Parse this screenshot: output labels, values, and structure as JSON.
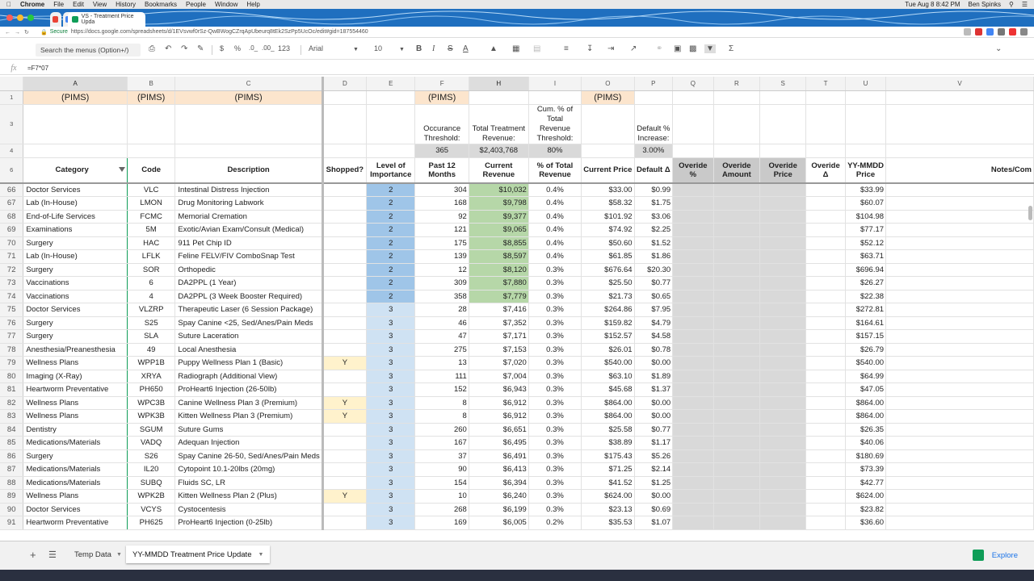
{
  "mac_menu": {
    "app": "Chrome",
    "items": [
      "File",
      "Edit",
      "View",
      "History",
      "Bookmarks",
      "People",
      "Window",
      "Help"
    ],
    "clock": "Tue Aug 8  8:42 PM",
    "user": "Ben Spinks"
  },
  "browser": {
    "tabs": [
      {
        "label": "VS - Treatment Price Upda",
        "active": true
      }
    ],
    "secure_label": "Secure",
    "url": "https://docs.google.com/spreadsheets/d/1EVsvwf0rSz-QwBWogCZrqApUbeurq8tEk2SzPp5UcOc/edit#gid=187554460"
  },
  "toolbar": {
    "search_placeholder": "Search the menus (Option+/)",
    "buttons": [
      "print",
      "undo",
      "redo",
      "paint-format",
      "$",
      "%",
      ".0_",
      ".00_",
      "123"
    ],
    "font": "Arial",
    "font_size": "10"
  },
  "formula_bar": {
    "fx": "fx",
    "formula": "=F7*07"
  },
  "columns": [
    "A",
    "B",
    "C",
    "D",
    "E",
    "F",
    "H",
    "I",
    "O",
    "P",
    "Q",
    "R",
    "S",
    "T",
    "U",
    "V"
  ],
  "header_rows": {
    "row1": {
      "rownum": "1",
      "A": "(PIMS)",
      "B": "(PIMS)",
      "C": "(PIMS)",
      "F": "(PIMS)",
      "O": "(PIMS)"
    },
    "row3": {
      "rownum": "3",
      "F": "Occurance Threshold:",
      "H": "Total Treatment Revenue:",
      "I": "Cum. % of Total Revenue Threshold:",
      "P": "Default % Increase:"
    },
    "row4": {
      "rownum": "4",
      "F": "365",
      "H": "$2,403,768",
      "I": "80%",
      "P": "3.00%"
    },
    "row6": {
      "rownum": "6",
      "A": "Category",
      "B": "Code",
      "C": "Description",
      "D": "Shopped?",
      "E": "Level of Importance",
      "F": "Past 12 Months",
      "H": "Current Revenue",
      "I": "% of Total Revenue",
      "O": "Current Price",
      "P": "Default Δ",
      "Q": "Overide %",
      "R": "Overide Amount",
      "S": "Overide Price",
      "T": "Overide Δ",
      "U": "YY-MMDD Price",
      "V": "Notes/Com"
    }
  },
  "rows": [
    {
      "n": "66",
      "cat": "Doctor Services",
      "code": "VLC",
      "desc": "Intestinal Distress Injection",
      "shop": "",
      "lvl": "2",
      "past": "304",
      "rev": "$10,032",
      "pct": "0.4%",
      "price": "$33.00",
      "delta": "$0.99",
      "yy": "$33.99"
    },
    {
      "n": "67",
      "cat": "Lab (In-House)",
      "code": "LMON",
      "desc": "Drug Monitoring Labwork",
      "shop": "",
      "lvl": "2",
      "past": "168",
      "rev": "$9,798",
      "pct": "0.4%",
      "price": "$58.32",
      "delta": "$1.75",
      "yy": "$60.07"
    },
    {
      "n": "68",
      "cat": "End-of-Life Services",
      "code": "FCMC",
      "desc": "Memorial Cremation",
      "shop": "",
      "lvl": "2",
      "past": "92",
      "rev": "$9,377",
      "pct": "0.4%",
      "price": "$101.92",
      "delta": "$3.06",
      "yy": "$104.98"
    },
    {
      "n": "69",
      "cat": "Examinations",
      "code": "5M",
      "desc": "Exotic/Avian Exam/Consult (Medical)",
      "shop": "",
      "lvl": "2",
      "past": "121",
      "rev": "$9,065",
      "pct": "0.4%",
      "price": "$74.92",
      "delta": "$2.25",
      "yy": "$77.17"
    },
    {
      "n": "70",
      "cat": "Surgery",
      "code": "HAC",
      "desc": "911 Pet Chip ID",
      "shop": "",
      "lvl": "2",
      "past": "175",
      "rev": "$8,855",
      "pct": "0.4%",
      "price": "$50.60",
      "delta": "$1.52",
      "yy": "$52.12"
    },
    {
      "n": "71",
      "cat": "Lab (In-House)",
      "code": "LFLK",
      "desc": "Feline FELV/FIV ComboSnap Test",
      "shop": "",
      "lvl": "2",
      "past": "139",
      "rev": "$8,597",
      "pct": "0.4%",
      "price": "$61.85",
      "delta": "$1.86",
      "yy": "$63.71"
    },
    {
      "n": "72",
      "cat": "Surgery",
      "code": "SOR",
      "desc": "Orthopedic",
      "shop": "",
      "lvl": "2",
      "past": "12",
      "rev": "$8,120",
      "pct": "0.3%",
      "price": "$676.64",
      "delta": "$20.30",
      "yy": "$696.94"
    },
    {
      "n": "73",
      "cat": "Vaccinations",
      "code": "6",
      "desc": "DA2PPL (1 Year)",
      "shop": "",
      "lvl": "2",
      "past": "309",
      "rev": "$7,880",
      "pct": "0.3%",
      "price": "$25.50",
      "delta": "$0.77",
      "yy": "$26.27"
    },
    {
      "n": "74",
      "cat": "Vaccinations",
      "code": "4",
      "desc": "DA2PPL (3 Week Booster Required)",
      "shop": "",
      "lvl": "2",
      "past": "358",
      "rev": "$7,779",
      "pct": "0.3%",
      "price": "$21.73",
      "delta": "$0.65",
      "yy": "$22.38"
    },
    {
      "n": "75",
      "cat": "Doctor Services",
      "code": "VLZRP",
      "desc": "Therapeutic Laser (6 Session Package)",
      "shop": "",
      "lvl": "3",
      "past": "28",
      "rev": "$7,416",
      "pct": "0.3%",
      "price": "$264.86",
      "delta": "$7.95",
      "yy": "$272.81"
    },
    {
      "n": "76",
      "cat": "Surgery",
      "code": "S25",
      "desc": "Spay Canine <25, Sed/Anes/Pain Meds",
      "shop": "",
      "lvl": "3",
      "past": "46",
      "rev": "$7,352",
      "pct": "0.3%",
      "price": "$159.82",
      "delta": "$4.79",
      "yy": "$164.61"
    },
    {
      "n": "77",
      "cat": "Surgery",
      "code": "SLA",
      "desc": "Suture Laceration",
      "shop": "",
      "lvl": "3",
      "past": "47",
      "rev": "$7,171",
      "pct": "0.3%",
      "price": "$152.57",
      "delta": "$4.58",
      "yy": "$157.15"
    },
    {
      "n": "78",
      "cat": "Anesthesia/Preanesthesia",
      "code": "49",
      "desc": "Local Anesthesia",
      "shop": "",
      "lvl": "3",
      "past": "275",
      "rev": "$7,153",
      "pct": "0.3%",
      "price": "$26.01",
      "delta": "$0.78",
      "yy": "$26.79"
    },
    {
      "n": "79",
      "cat": "Wellness Plans",
      "code": "WPP1B",
      "desc": "Puppy Wellness Plan 1 (Basic)",
      "shop": "Y",
      "lvl": "3",
      "past": "13",
      "rev": "$7,020",
      "pct": "0.3%",
      "price": "$540.00",
      "delta": "$0.00",
      "yy": "$540.00"
    },
    {
      "n": "80",
      "cat": "Imaging (X-Ray)",
      "code": "XRYA",
      "desc": "Radiograph (Additional View)",
      "shop": "",
      "lvl": "3",
      "past": "111",
      "rev": "$7,004",
      "pct": "0.3%",
      "price": "$63.10",
      "delta": "$1.89",
      "yy": "$64.99"
    },
    {
      "n": "81",
      "cat": "Heartworm Preventative",
      "code": "PH650",
      "desc": "ProHeart6 Injection (26-50lb)",
      "shop": "",
      "lvl": "3",
      "past": "152",
      "rev": "$6,943",
      "pct": "0.3%",
      "price": "$45.68",
      "delta": "$1.37",
      "yy": "$47.05"
    },
    {
      "n": "82",
      "cat": "Wellness Plans",
      "code": "WPC3B",
      "desc": "Canine Wellness Plan 3 (Premium)",
      "shop": "Y",
      "lvl": "3",
      "past": "8",
      "rev": "$6,912",
      "pct": "0.3%",
      "price": "$864.00",
      "delta": "$0.00",
      "yy": "$864.00"
    },
    {
      "n": "83",
      "cat": "Wellness Plans",
      "code": "WPK3B",
      "desc": "Kitten Wellness Plan 3 (Premium)",
      "shop": "Y",
      "lvl": "3",
      "past": "8",
      "rev": "$6,912",
      "pct": "0.3%",
      "price": "$864.00",
      "delta": "$0.00",
      "yy": "$864.00"
    },
    {
      "n": "84",
      "cat": "Dentistry",
      "code": "SGUM",
      "desc": "Suture Gums",
      "shop": "",
      "lvl": "3",
      "past": "260",
      "rev": "$6,651",
      "pct": "0.3%",
      "price": "$25.58",
      "delta": "$0.77",
      "yy": "$26.35"
    },
    {
      "n": "85",
      "cat": "Medications/Materials",
      "code": "VADQ",
      "desc": "Adequan Injection",
      "shop": "",
      "lvl": "3",
      "past": "167",
      "rev": "$6,495",
      "pct": "0.3%",
      "price": "$38.89",
      "delta": "$1.17",
      "yy": "$40.06"
    },
    {
      "n": "86",
      "cat": "Surgery",
      "code": "S26",
      "desc": "Spay Canine 26-50, Sed/Anes/Pain Meds",
      "shop": "",
      "lvl": "3",
      "past": "37",
      "rev": "$6,491",
      "pct": "0.3%",
      "price": "$175.43",
      "delta": "$5.26",
      "yy": "$180.69"
    },
    {
      "n": "87",
      "cat": "Medications/Materials",
      "code": "IL20",
      "desc": "Cytopoint 10.1-20lbs (20mg)",
      "shop": "",
      "lvl": "3",
      "past": "90",
      "rev": "$6,413",
      "pct": "0.3%",
      "price": "$71.25",
      "delta": "$2.14",
      "yy": "$73.39"
    },
    {
      "n": "88",
      "cat": "Medications/Materials",
      "code": "SUBQ",
      "desc": "Fluids SC, LR",
      "shop": "",
      "lvl": "3",
      "past": "154",
      "rev": "$6,394",
      "pct": "0.3%",
      "price": "$41.52",
      "delta": "$1.25",
      "yy": "$42.77"
    },
    {
      "n": "89",
      "cat": "Wellness Plans",
      "code": "WPK2B",
      "desc": "Kitten Wellness Plan 2 (Plus)",
      "shop": "Y",
      "lvl": "3",
      "past": "10",
      "rev": "$6,240",
      "pct": "0.3%",
      "price": "$624.00",
      "delta": "$0.00",
      "yy": "$624.00"
    },
    {
      "n": "90",
      "cat": "Doctor Services",
      "code": "VCYS",
      "desc": "Cystocentesis",
      "shop": "",
      "lvl": "3",
      "past": "268",
      "rev": "$6,199",
      "pct": "0.3%",
      "price": "$23.13",
      "delta": "$0.69",
      "yy": "$23.82"
    },
    {
      "n": "91",
      "cat": "Heartworm Preventative",
      "code": "PH625",
      "desc": "ProHeart6 Injection (0-25lb)",
      "shop": "",
      "lvl": "3",
      "past": "169",
      "rev": "$6,005",
      "pct": "0.2%",
      "price": "$35.53",
      "delta": "$1.07",
      "yy": "$36.60"
    }
  ],
  "sheets": [
    {
      "label": "Temp Data",
      "active": false
    },
    {
      "label": "YY-MMDD Treatment Price Update",
      "active": true
    }
  ],
  "explore_label": "Explore"
}
